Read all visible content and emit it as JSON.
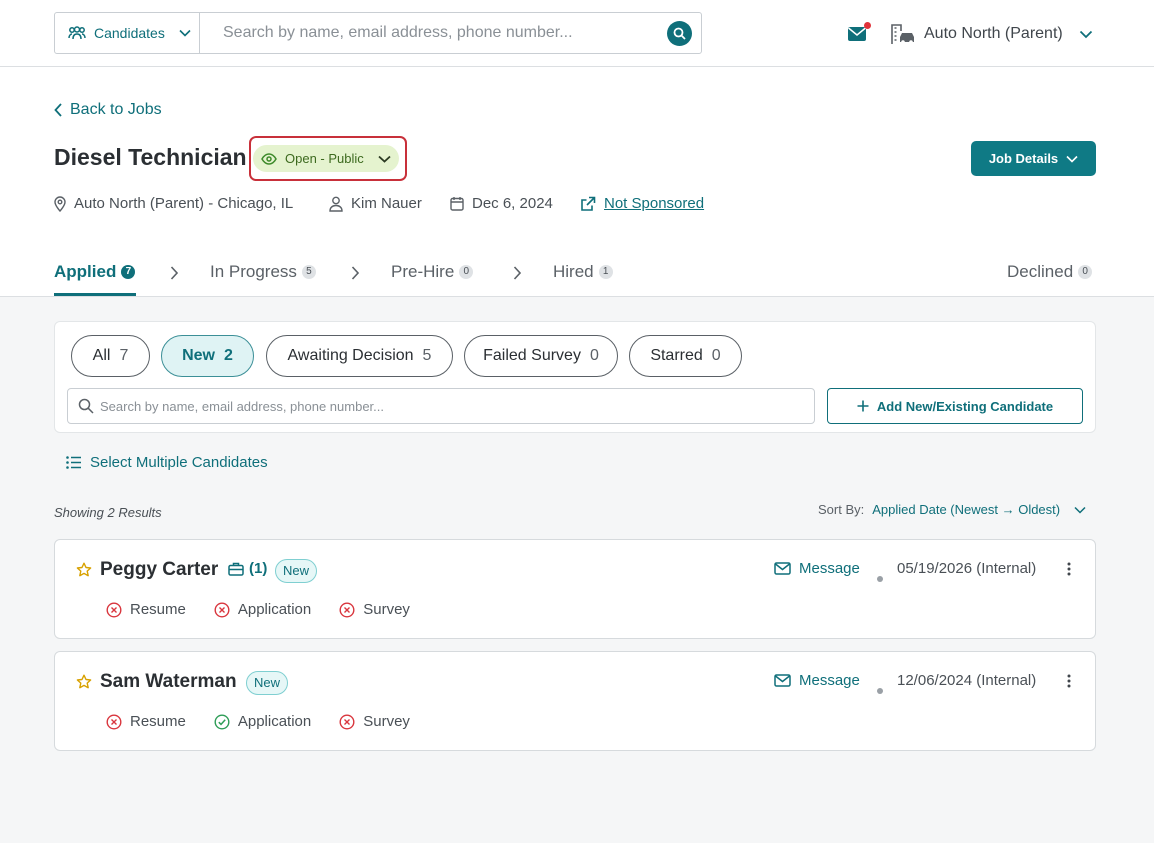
{
  "topbar": {
    "scope_label": "Candidates",
    "search_placeholder": "Search by name, email address, phone number...",
    "org_name": "Auto North (Parent)"
  },
  "header": {
    "back_label": "Back to Jobs",
    "job_title": "Diesel Technician",
    "status_label": "Open - Public",
    "job_details_label": "Job Details",
    "location": "Auto North (Parent) - Chicago, IL",
    "recruiter": "Kim Nauer",
    "date": "Dec 6, 2024",
    "sponsorship": "Not Sponsored"
  },
  "pipeline": [
    {
      "label": "Applied",
      "count": "7"
    },
    {
      "label": "In Progress",
      "count": "5"
    },
    {
      "label": "Pre-Hire",
      "count": "0"
    },
    {
      "label": "Hired",
      "count": "1"
    },
    {
      "label": "Declined",
      "count": "0"
    }
  ],
  "filters": [
    {
      "label": "All",
      "count": "7"
    },
    {
      "label": "New",
      "count": "2"
    },
    {
      "label": "Awaiting Decision",
      "count": "5"
    },
    {
      "label": "Failed Survey",
      "count": "0"
    },
    {
      "label": "Starred",
      "count": "0"
    }
  ],
  "list_search_placeholder": "Search by name, email address, phone number...",
  "add_candidate_label": "Add New/Existing Candidate",
  "select_multiple_label": "Select Multiple Candidates",
  "results_label": "Showing 2 Results",
  "sort": {
    "label": "Sort By:",
    "value": "Applied Date (Newest → Oldest)"
  },
  "candidates": [
    {
      "name": "Peggy Carter",
      "case_count": "(1)",
      "badge": "New",
      "message_label": "Message",
      "date": "05/19/2026 (Internal)",
      "docs": [
        {
          "label": "Resume",
          "status": "missing"
        },
        {
          "label": "Application",
          "status": "missing"
        },
        {
          "label": "Survey",
          "status": "missing"
        }
      ]
    },
    {
      "name": "Sam Waterman",
      "badge": "New",
      "message_label": "Message",
      "date": "12/06/2024 (Internal)",
      "docs": [
        {
          "label": "Resume",
          "status": "missing"
        },
        {
          "label": "Application",
          "status": "complete"
        },
        {
          "label": "Survey",
          "status": "missing"
        }
      ]
    }
  ],
  "colors": {
    "accent": "#0f6f7a",
    "status_bg": "#e5f3cf",
    "error": "#d9363e",
    "success": "#2e9d57",
    "highlight": "#c8303a"
  }
}
